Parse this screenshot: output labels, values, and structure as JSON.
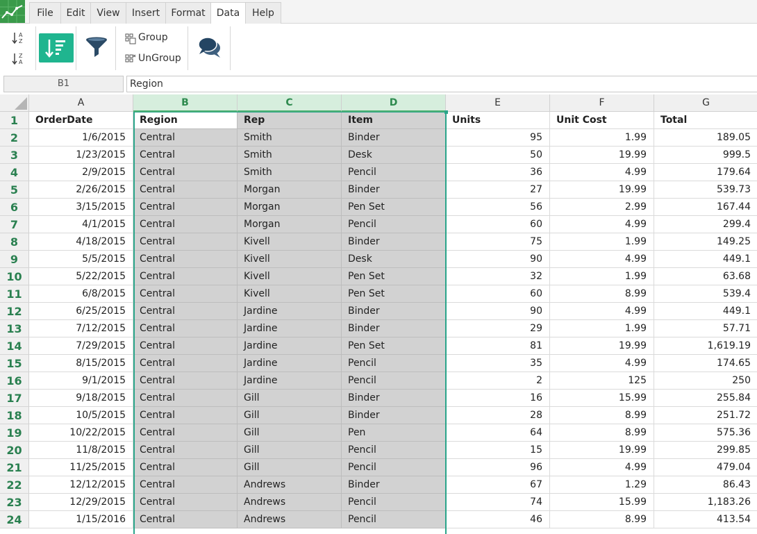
{
  "menu": [
    "File",
    "Edit",
    "View",
    "Insert",
    "Format",
    "Data",
    "Help"
  ],
  "active_menu": "Data",
  "ribbon": {
    "sort_asc_icon": "sort-az-icon",
    "sort_desc_icon": "sort-za-icon",
    "sort_custom_icon": "sort-custom-icon",
    "filter_icon": "funnel-icon",
    "group_label": "Group",
    "ungroup_label": "UnGroup",
    "comments_icon": "chat-bubbles-icon",
    "accent_color": "#1fb58f"
  },
  "formula_bar": {
    "name_box": "B1",
    "value": "Region"
  },
  "columns": [
    "A",
    "B",
    "C",
    "D",
    "E",
    "F",
    "G"
  ],
  "selected_columns": [
    "B",
    "C",
    "D"
  ],
  "header_row": [
    "OrderDate",
    "Region",
    "Rep",
    "Item",
    "Units",
    "Unit Cost",
    "Total"
  ],
  "rows": [
    [
      "1/6/2015",
      "Central",
      "Smith",
      "Binder",
      "95",
      "1.99",
      "189.05"
    ],
    [
      "1/23/2015",
      "Central",
      "Smith",
      "Desk",
      "50",
      "19.99",
      "999.5"
    ],
    [
      "2/9/2015",
      "Central",
      "Smith",
      "Pencil",
      "36",
      "4.99",
      "179.64"
    ],
    [
      "2/26/2015",
      "Central",
      "Morgan",
      "Binder",
      "27",
      "19.99",
      "539.73"
    ],
    [
      "3/15/2015",
      "Central",
      "Morgan",
      "Pen Set",
      "56",
      "2.99",
      "167.44"
    ],
    [
      "4/1/2015",
      "Central",
      "Morgan",
      "Pencil",
      "60",
      "4.99",
      "299.4"
    ],
    [
      "4/18/2015",
      "Central",
      "Kivell",
      "Binder",
      "75",
      "1.99",
      "149.25"
    ],
    [
      "5/5/2015",
      "Central",
      "Kivell",
      "Desk",
      "90",
      "4.99",
      "449.1"
    ],
    [
      "5/22/2015",
      "Central",
      "Kivell",
      "Pen Set",
      "32",
      "1.99",
      "63.68"
    ],
    [
      "6/8/2015",
      "Central",
      "Kivell",
      "Pen Set",
      "60",
      "8.99",
      "539.4"
    ],
    [
      "6/25/2015",
      "Central",
      "Jardine",
      "Binder",
      "90",
      "4.99",
      "449.1"
    ],
    [
      "7/12/2015",
      "Central",
      "Jardine",
      "Binder",
      "29",
      "1.99",
      "57.71"
    ],
    [
      "7/29/2015",
      "Central",
      "Jardine",
      "Pen Set",
      "81",
      "19.99",
      "1,619.19"
    ],
    [
      "8/15/2015",
      "Central",
      "Jardine",
      "Pencil",
      "35",
      "4.99",
      "174.65"
    ],
    [
      "9/1/2015",
      "Central",
      "Jardine",
      "Pencil",
      "2",
      "125",
      "250"
    ],
    [
      "9/18/2015",
      "Central",
      "Gill",
      "Binder",
      "16",
      "15.99",
      "255.84"
    ],
    [
      "10/5/2015",
      "Central",
      "Gill",
      "Binder",
      "28",
      "8.99",
      "251.72"
    ],
    [
      "10/22/2015",
      "Central",
      "Gill",
      "Pen",
      "64",
      "8.99",
      "575.36"
    ],
    [
      "11/8/2015",
      "Central",
      "Gill",
      "Pencil",
      "15",
      "19.99",
      "299.85"
    ],
    [
      "11/25/2015",
      "Central",
      "Gill",
      "Pencil",
      "96",
      "4.99",
      "479.04"
    ],
    [
      "12/12/2015",
      "Central",
      "Andrews",
      "Binder",
      "67",
      "1.29",
      "86.43"
    ],
    [
      "12/29/2015",
      "Central",
      "Andrews",
      "Pencil",
      "74",
      "15.99",
      "1,183.26"
    ],
    [
      "1/15/2016",
      "Central",
      "Andrews",
      "Pencil",
      "46",
      "8.99",
      "413.54"
    ]
  ]
}
